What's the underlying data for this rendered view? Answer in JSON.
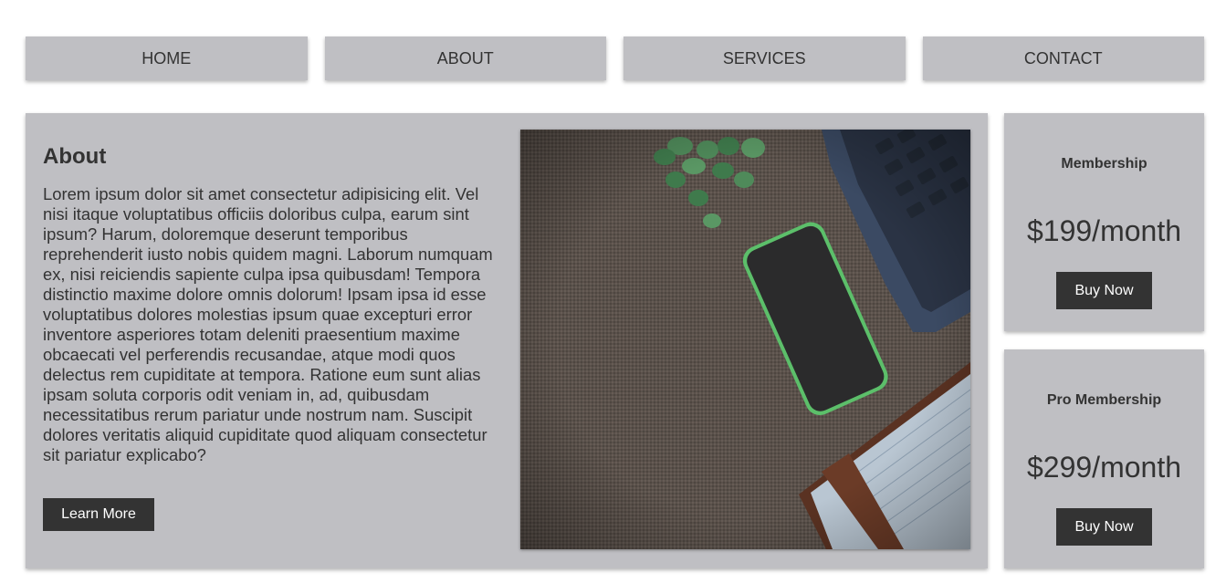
{
  "nav": {
    "items": [
      {
        "label": "HOME"
      },
      {
        "label": "ABOUT"
      },
      {
        "label": "SERVICES"
      },
      {
        "label": "CONTACT"
      }
    ]
  },
  "about": {
    "title": "About",
    "body": "Lorem ipsum dolor sit amet consectetur adipisicing elit. Vel nisi itaque voluptatibus officiis doloribus culpa, earum sint ipsum? Harum, doloremque deserunt temporibus reprehenderit iusto nobis quidem magni. Laborum numquam ex, nisi reiciendis sapiente culpa ipsa quibusdam! Tempora distinctio maxime dolore omnis dolorum! Ipsam ipsa id esse voluptatibus dolores molestias ipsum quae excepturi error inventore asperiores totam deleniti praesentium maxime obcaecati vel perferendis recusandae, atque modi quos delectus rem cupiditate at tempora. Ratione eum sunt alias ipsam soluta corporis odit veniam in, ad, quibusdam necessitatibus rerum pariatur unde nostrum nam. Suscipit dolores veritatis aliquid cupiditate quod aliquam consectetur sit pariatur explicabo?",
    "button_label": "Learn More",
    "image_icon": "desk-photo"
  },
  "plans": [
    {
      "name": "Membership",
      "price": "$199/month",
      "button_label": "Buy Now"
    },
    {
      "name": "Pro Membership",
      "price": "$299/month",
      "button_label": "Buy Now"
    }
  ],
  "colors": {
    "card_bg": "#bfbfc3",
    "button_bg": "#333333",
    "text": "#333333"
  }
}
